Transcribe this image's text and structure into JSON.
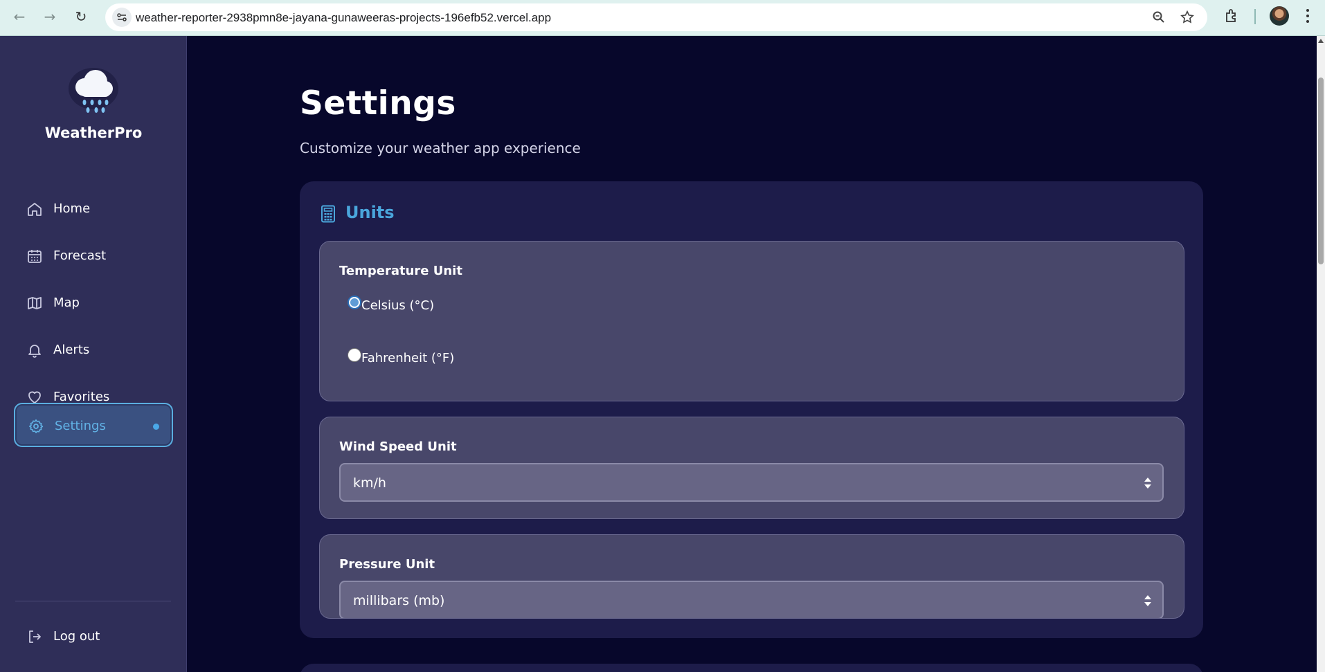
{
  "browser": {
    "url": "weather-reporter-2938pmn8e-jayana-gunaweeras-projects-196efb52.vercel.app"
  },
  "sidebar": {
    "brand": "WeatherPro",
    "items": [
      {
        "label": "Home",
        "icon": "home-icon"
      },
      {
        "label": "Forecast",
        "icon": "calendar-icon"
      },
      {
        "label": "Map",
        "icon": "map-icon"
      },
      {
        "label": "Alerts",
        "icon": "bell-icon"
      },
      {
        "label": "Favorites",
        "icon": "heart-icon"
      },
      {
        "label": "Settings",
        "icon": "gear-icon",
        "active": true
      }
    ],
    "logout": "Log out"
  },
  "main": {
    "title": "Settings",
    "subtitle": "Customize your weather app experience",
    "units_card": {
      "title": "Units",
      "temperature": {
        "label": "Temperature Unit",
        "options": [
          "Celsius (°C)",
          "Fahrenheit (°F)"
        ],
        "selected": "Celsius (°C)"
      },
      "wind": {
        "label": "Wind Speed Unit",
        "value": "km/h"
      },
      "pressure": {
        "label": "Pressure Unit",
        "value": "millibars (mb)"
      }
    }
  },
  "colors": {
    "background": "#07072b",
    "sidebar": "#2f2e58",
    "accent": "#4aa6dc",
    "panel": "#48476a"
  }
}
